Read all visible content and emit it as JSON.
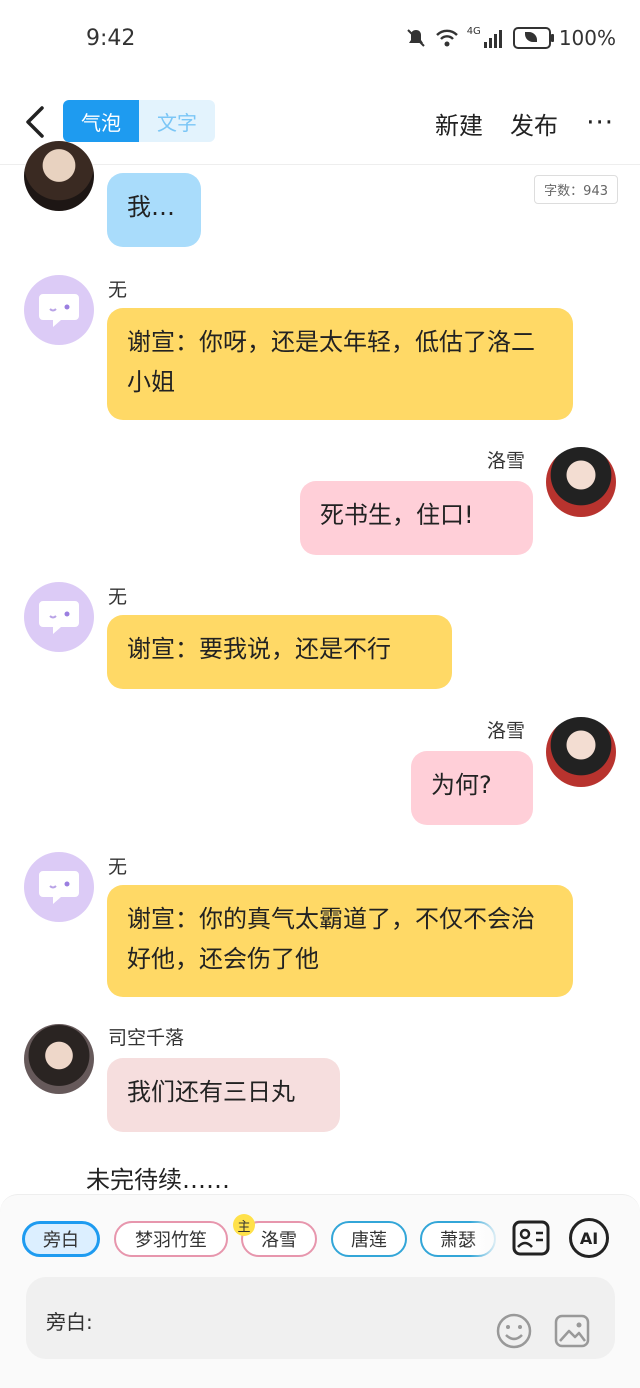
{
  "status": {
    "time": "9:42",
    "network": "4G",
    "battery": "100%"
  },
  "header": {
    "tab_bubble": "气泡",
    "tab_text": "文字",
    "new": "新建",
    "publish": "发布",
    "more": "···"
  },
  "word_count": "字数：943",
  "messages": [
    {
      "side": "left",
      "speaker": "",
      "text": "我…",
      "avatar": "dark-character-avatar"
    },
    {
      "side": "left",
      "speaker": "无",
      "text": "谢宣：你呀，还是太年轻，低估了洛二小姐",
      "avatar": "bot-avatar"
    },
    {
      "side": "right",
      "speaker": "洛雪",
      "text": "死书生，住口!",
      "avatar": "luoxue-avatar"
    },
    {
      "side": "left",
      "speaker": "无",
      "text": "谢宣：要我说，还是不行",
      "avatar": "bot-avatar"
    },
    {
      "side": "right",
      "speaker": "洛雪",
      "text": "为何?",
      "avatar": "luoxue-avatar"
    },
    {
      "side": "left",
      "speaker": "无",
      "text": "谢宣：你的真气太霸道了，不仅不会治好他，还会伤了他",
      "avatar": "bot-avatar"
    },
    {
      "side": "left",
      "speaker": "司空千落",
      "text": "我们还有三日丸",
      "avatar": "sikong-avatar"
    }
  ],
  "to_be_continued": "未完待续……",
  "roles": [
    {
      "label": "旁白",
      "selected": true
    },
    {
      "label": "梦羽竹笙",
      "selected": false
    },
    {
      "label": "洛雪",
      "selected": false,
      "badge": "主"
    },
    {
      "label": "唐莲",
      "selected": false
    },
    {
      "label": "萧瑟",
      "selected": false
    }
  ],
  "ai_button": "AI",
  "input": {
    "label": "旁白:"
  },
  "colors": {
    "accent": "#1e9bf0",
    "yellow_bubble": "#ffd966",
    "pink_bubble": "#ffcfd8",
    "blue_bubble": "#a9dcfb"
  }
}
